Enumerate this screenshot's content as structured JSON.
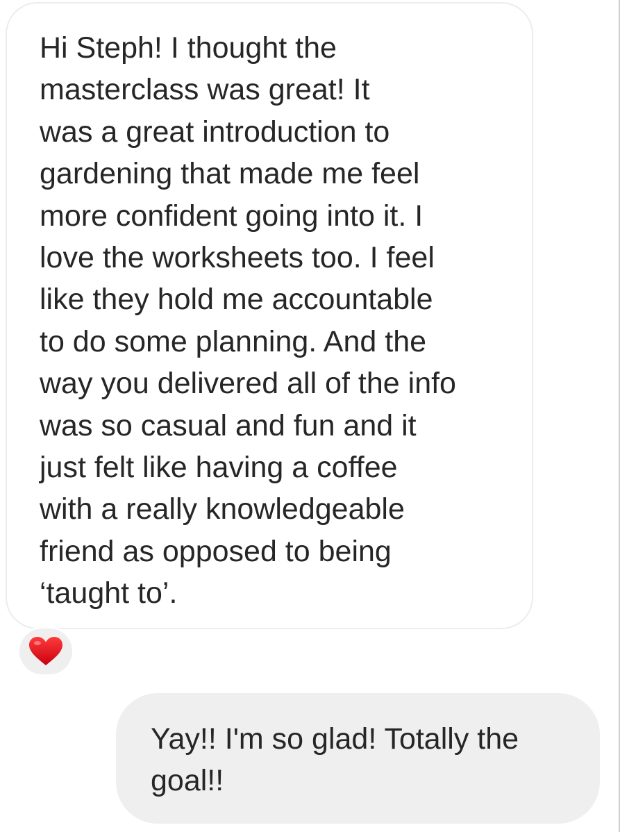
{
  "messages": [
    {
      "direction": "received",
      "text": "Hi Steph! I thought the\nmasterclass was great! It\nwas a great introduction to\ngardening that made me feel\nmore confident going into it. I\nlove the worksheets too. I feel\nlike they hold me accountable\nto do some planning. And the\nway you delivered all of the info\nwas so casual and fun and it\njust felt like having a coffee\nwith a really knowledgeable\nfriend as opposed to being\n‘taught to’.",
      "reaction": "heart-icon"
    },
    {
      "direction": "sent",
      "text": "Yay!! I'm so glad! Totally the\ngoal!!"
    }
  ],
  "colors": {
    "received_bubble_bg": "#ffffff",
    "received_bubble_border": "#ececec",
    "sent_bubble_bg": "#efefef",
    "reaction_bg": "#efefef",
    "heart": "#e0141e",
    "text": "#262626"
  }
}
